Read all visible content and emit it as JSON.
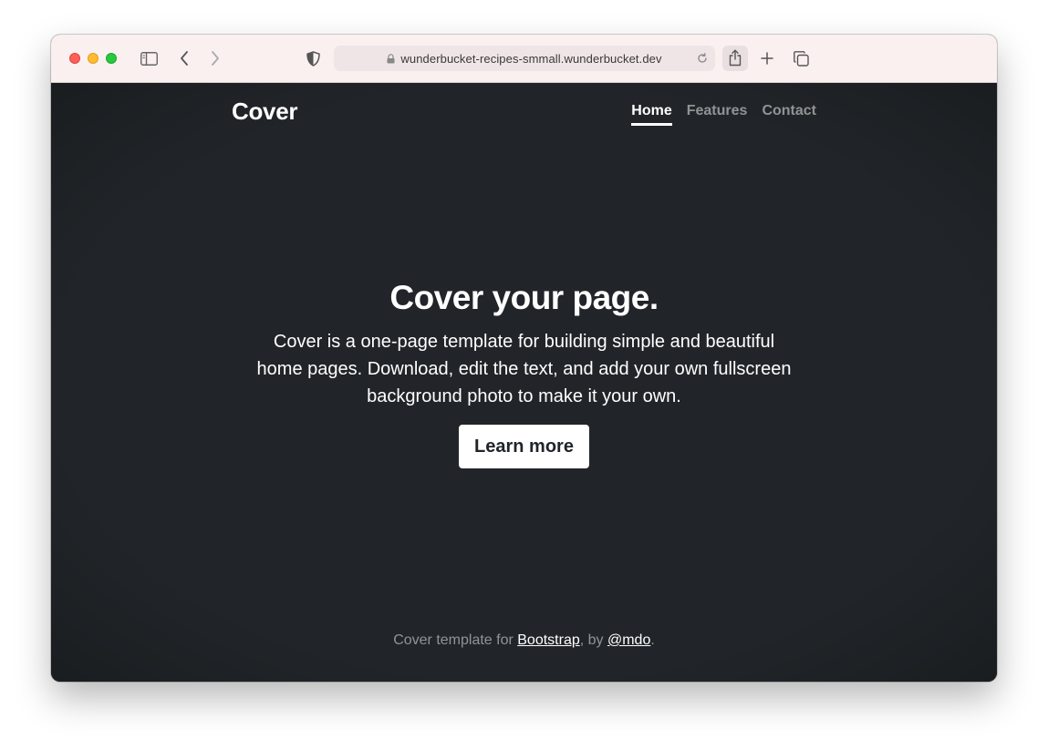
{
  "browser": {
    "url": "wunderbucket-recipes-smmall.wunderbucket.dev",
    "icons": [
      "sidebar-icon",
      "back-icon",
      "forward-icon",
      "shield-icon",
      "lock-icon",
      "reload-icon",
      "share-icon",
      "new-tab-icon",
      "tabs-overview-icon"
    ]
  },
  "header": {
    "brand": "Cover",
    "nav": [
      {
        "label": "Home",
        "active": true
      },
      {
        "label": "Features",
        "active": false
      },
      {
        "label": "Contact",
        "active": false
      }
    ]
  },
  "hero": {
    "title": "Cover your page.",
    "lead": "Cover is a one-page template for building simple and beautiful home pages. Download, edit the text, and add your own fullscreen background photo to make it your own.",
    "button": "Learn more"
  },
  "footer": {
    "prefix": "Cover template for ",
    "link1": "Bootstrap",
    "middle": ", by ",
    "link2": "@mdo",
    "suffix": "."
  },
  "colors": {
    "page_bg": "#212529",
    "toolbar_bg": "#fbf0f0",
    "text": "#ffffff",
    "muted": "rgba(255,255,255,0.5)"
  }
}
